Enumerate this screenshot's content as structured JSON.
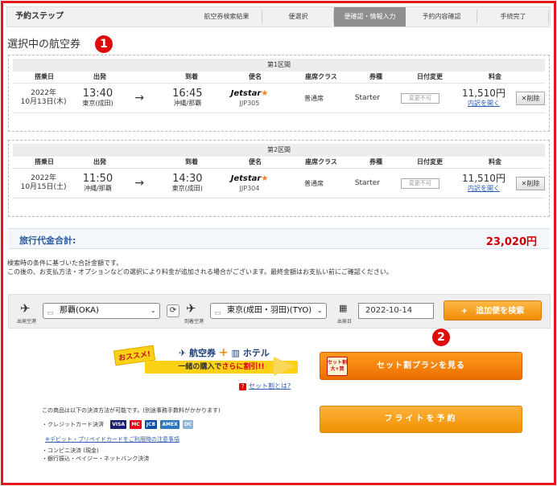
{
  "steps": {
    "title": "予約ステップ",
    "items": [
      "航空券検索結果",
      "便選択",
      "便確認・情報入力",
      "予約内容確認",
      "手続完了"
    ],
    "active_index": 2
  },
  "section_title": "選択中の航空券",
  "badges": [
    "1",
    "2"
  ],
  "columns": [
    "搭乗日",
    "出発",
    "到着",
    "便名",
    "座席クラス",
    "券種",
    "日付変更",
    "料金"
  ],
  "segments": [
    {
      "header": "第1区間",
      "year": "2022年",
      "date": "10月13日(木)",
      "dep_time": "13:40",
      "dep_airport": "東京(成田)",
      "arrow": "→",
      "arr_time": "16:45",
      "arr_airport": "沖縄/那覇",
      "airline": "Jetstar",
      "flight_no": "JJP305",
      "seat_class": "普通席",
      "fare_type": "Starter",
      "change": "変更不可",
      "price": "11,510円",
      "detail": "内訳を開く",
      "delete": "削除"
    },
    {
      "header": "第2区間",
      "year": "2022年",
      "date": "10月15日(土)",
      "dep_time": "11:50",
      "dep_airport": "沖縄/那覇",
      "arrow": "→",
      "arr_time": "14:30",
      "arr_airport": "東京(成田)",
      "airline": "Jetstar",
      "flight_no": "JJP304",
      "seat_class": "普通席",
      "fare_type": "Starter",
      "change": "変更不可",
      "price": "11,510円",
      "detail": "内訳を開く",
      "delete": "削除"
    }
  ],
  "total": {
    "label": "旅行代金合計:",
    "amount": "23,020円"
  },
  "notes": [
    "検索時の条件に基づいた合計金額です。",
    "この後の、お支払方法・オプションなどの選択により料金が追加される場合がございます。最終金額はお支払い前にご確認ください。"
  ],
  "search": {
    "dep_label": "出発空港",
    "dep_value": "那覇(OKA)",
    "arr_label": "到着空港",
    "arr_value": "東京(成田・羽田)(TYO)",
    "date_label": "出発日",
    "date_value": "2022-10-14",
    "add_button": "+　追加便を検索"
  },
  "promo": {
    "tag": "おススメ!",
    "text_1": "航空券",
    "plus": "+",
    "text_2": "ホテル",
    "sub_a": "一緒の購入で",
    "sub_b": "さらに割引!!",
    "link": "セット割とは?",
    "q": "?"
  },
  "set_button": {
    "icon_text_1": "セット割",
    "icon_text_2": "大+買",
    "label": "セット割プランを見る"
  },
  "flight_button": "フライトを予約",
  "payment": {
    "title": "この商品は以下の決済方法が可能です。(別途事務手数料がかかります)",
    "credit": "・クレジットカード決済",
    "cards": [
      "VISA",
      "MC",
      "JCB",
      "AMEX",
      "DC"
    ],
    "debit_link": "※デビット・プリペイドカードをご利用時の注意事項",
    "conv": "・コンビニ決済 (現金)",
    "bank": "・銀行振込・ペイジー・ネットバンク決済"
  },
  "colors": {
    "frame": "#e8141c",
    "accent_orange": "#f08c00",
    "total_red": "#d10000",
    "link_blue": "#2b5db6"
  }
}
